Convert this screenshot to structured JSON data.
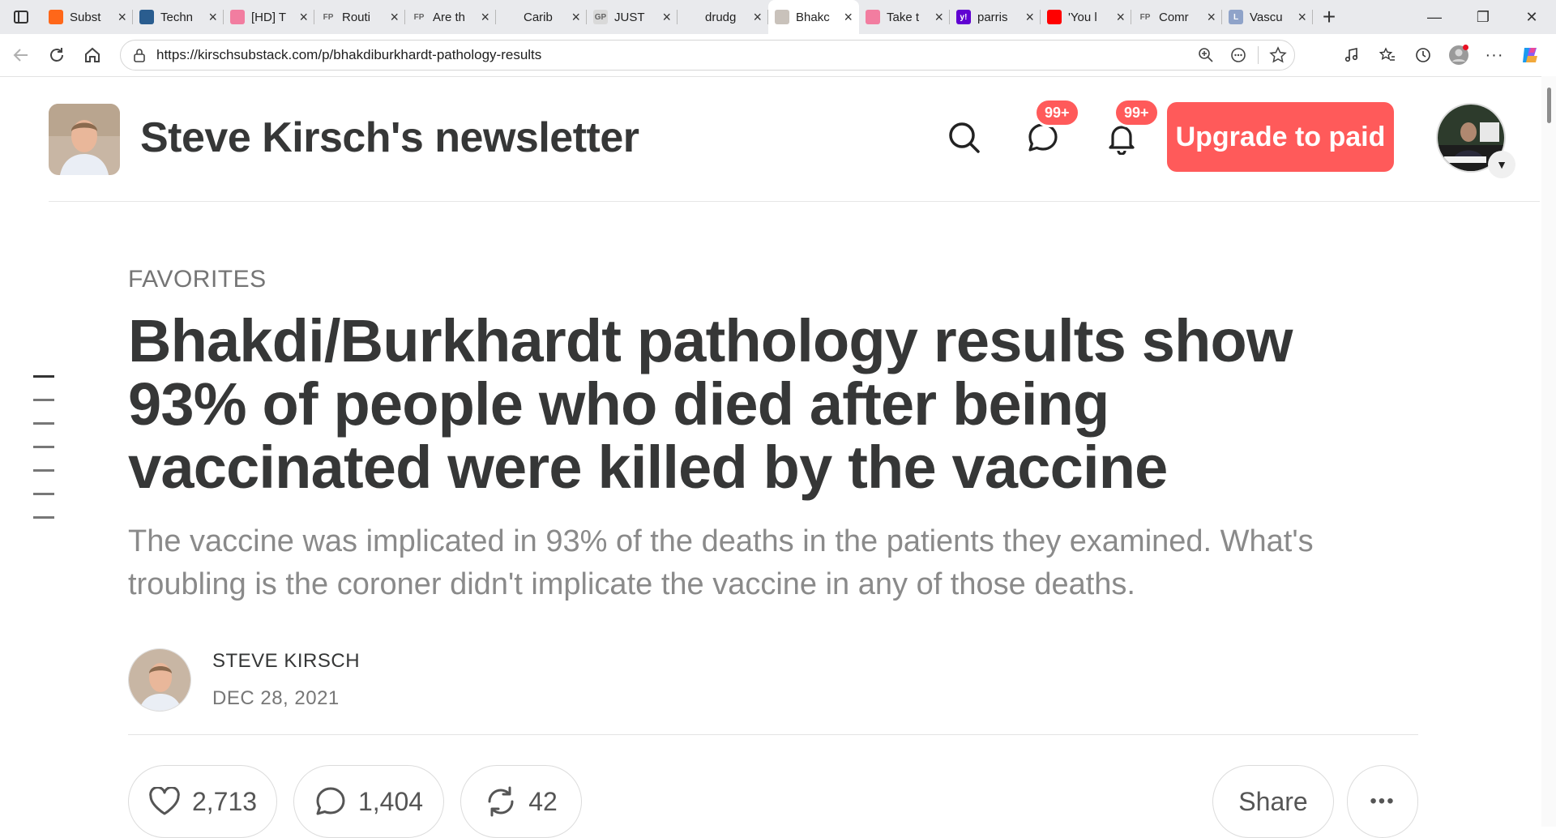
{
  "browser": {
    "tabs": [
      {
        "title": "Subst",
        "favicon_color": "#ff6719",
        "favicon_text": "",
        "active": false
      },
      {
        "title": "Techn",
        "favicon_color": "#2a5d8f",
        "favicon_text": "",
        "active": false
      },
      {
        "title": "[HD] T",
        "favicon_color": "#f27da0",
        "favicon_text": "",
        "active": false
      },
      {
        "title": "Routi",
        "favicon_color": "#e9eaed",
        "favicon_text": "FP",
        "active": false
      },
      {
        "title": "Are th",
        "favicon_color": "#e9eaed",
        "favicon_text": "FP",
        "active": false
      },
      {
        "title": "Carib",
        "favicon_color": "#e9eaed",
        "favicon_text": "",
        "active": false
      },
      {
        "title": "JUST",
        "favicon_color": "#d9d9d9",
        "favicon_text": "GP",
        "active": false
      },
      {
        "title": "drudg",
        "favicon_color": "#e9eaed",
        "favicon_text": "",
        "active": false
      },
      {
        "title": "Bhakc",
        "favicon_color": "#c9c2bb",
        "favicon_text": "",
        "active": true
      },
      {
        "title": "Take t",
        "favicon_color": "#f27da0",
        "favicon_text": "",
        "active": false
      },
      {
        "title": "parris",
        "favicon_color": "#6001d2",
        "favicon_text": "y!",
        "active": false
      },
      {
        "title": "'You l",
        "favicon_color": "#ff0000",
        "favicon_text": "",
        "active": false
      },
      {
        "title": "Comr",
        "favicon_color": "#e9eaed",
        "favicon_text": "FP",
        "active": false
      },
      {
        "title": "Vascu",
        "favicon_color": "#8fa3c9",
        "favicon_text": "L",
        "active": false
      }
    ],
    "url": "https://kirschsubstack.com/p/bhakdiburkhardt-pathology-results"
  },
  "header": {
    "site_title": "Steve Kirsch's newsletter",
    "chat_badge": "99+",
    "notif_badge": "99+",
    "upgrade_label": "Upgrade to paid",
    "accent_color": "#ff5a5a"
  },
  "article": {
    "eyebrow": "FAVORITES",
    "title": "Bhakdi/Burkhardt pathology results show 93% of people who died after being vaccinated were killed by the vaccine",
    "subtitle": "The vaccine was implicated in 93% of the deaths in the patients they examined. What's troubling is the coroner didn't implicate the vaccine in any of those deaths.",
    "author": "STEVE KIRSCH",
    "date": "DEC 28, 2021"
  },
  "actions": {
    "likes": "2,713",
    "comments": "1,404",
    "restacks": "42",
    "share_label": "Share",
    "more_label": "•••"
  }
}
